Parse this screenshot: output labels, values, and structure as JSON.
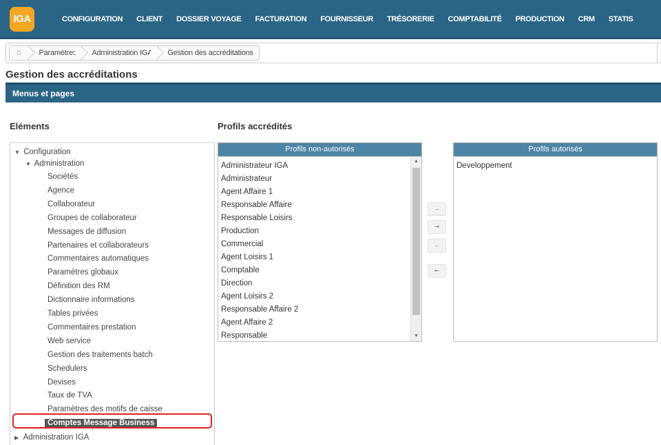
{
  "brand": {
    "logo_text": "IGA",
    "logo_color": "#f5a623",
    "nav_color": "#2b6585"
  },
  "nav": [
    "CONFIGURATION",
    "CLIENT",
    "DOSSIER VOYAGE",
    "FACTURATION",
    "FOURNISSEUR",
    "TRÉSORERIE",
    "COMPTABILITÉ",
    "PRODUCTION",
    "CRM",
    "STATIS"
  ],
  "breadcrumb": {
    "home_icon": "home-icon",
    "items": [
      "Paramètres",
      "Administration IGA",
      "Gestion des accréditations"
    ]
  },
  "page_title": "Gestion des accréditations",
  "section_title": "Menus et pages",
  "elements_heading": "Eléments",
  "profils_heading": "Profils accrédités",
  "tree": {
    "root": "Configuration",
    "group": "Administration",
    "items": [
      "Sociétés",
      "Agence",
      "Collaborateur",
      "Groupes de collaborateur",
      "Messages de diffusion",
      "Partenaires et collaborateurs",
      "Commentaires automatiques",
      "Paramètres globaux",
      "Définition des RM",
      "Dictionnaire informations",
      "Tables privées",
      "Commentaires prestation",
      "Web service",
      "Gestion des traitements batch",
      "Schedulers",
      "Devises",
      "Taux de TVA",
      "Paramètres des motifs de caisse",
      "Comptes Message Business"
    ],
    "selected": "Comptes Message Business",
    "next_group": "Administration IGA"
  },
  "unauthorized": {
    "header": "Profils non-autorisés",
    "items": [
      "Administrateur IGA",
      "Administrateur",
      "Agent Affaire 1",
      "Responsable Affaire",
      "Responsable Loisirs",
      "Production",
      "Commercial",
      "Agent Loisirs 1",
      "Comptable",
      "Direction",
      "Agent Loisirs 2",
      "Responsable Affaire 2",
      "Agent Affaire 2",
      "Responsable"
    ]
  },
  "authorized": {
    "header": "Profils autorisés",
    "items": [
      "Developpement"
    ]
  },
  "transfer_buttons": [
    {
      "name": "move-right-button",
      "glyph": "→"
    },
    {
      "name": "move-all-right-button",
      "glyph": "⇥"
    },
    {
      "name": "move-left-button",
      "glyph": "←"
    },
    {
      "name": "move-all-left-button",
      "glyph": "⇤"
    }
  ]
}
